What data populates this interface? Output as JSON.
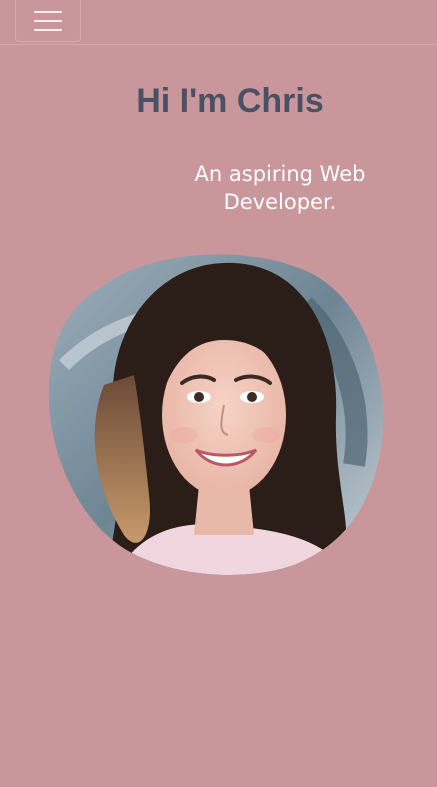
{
  "header": {
    "menu_icon": "hamburger-menu-icon"
  },
  "hero": {
    "title": "Hi I'm Chris",
    "subtitle": "An aspiring Web Developer."
  },
  "colors": {
    "background": "#c9969b",
    "title": "#4a5164",
    "subtitle": "#ffffff"
  }
}
